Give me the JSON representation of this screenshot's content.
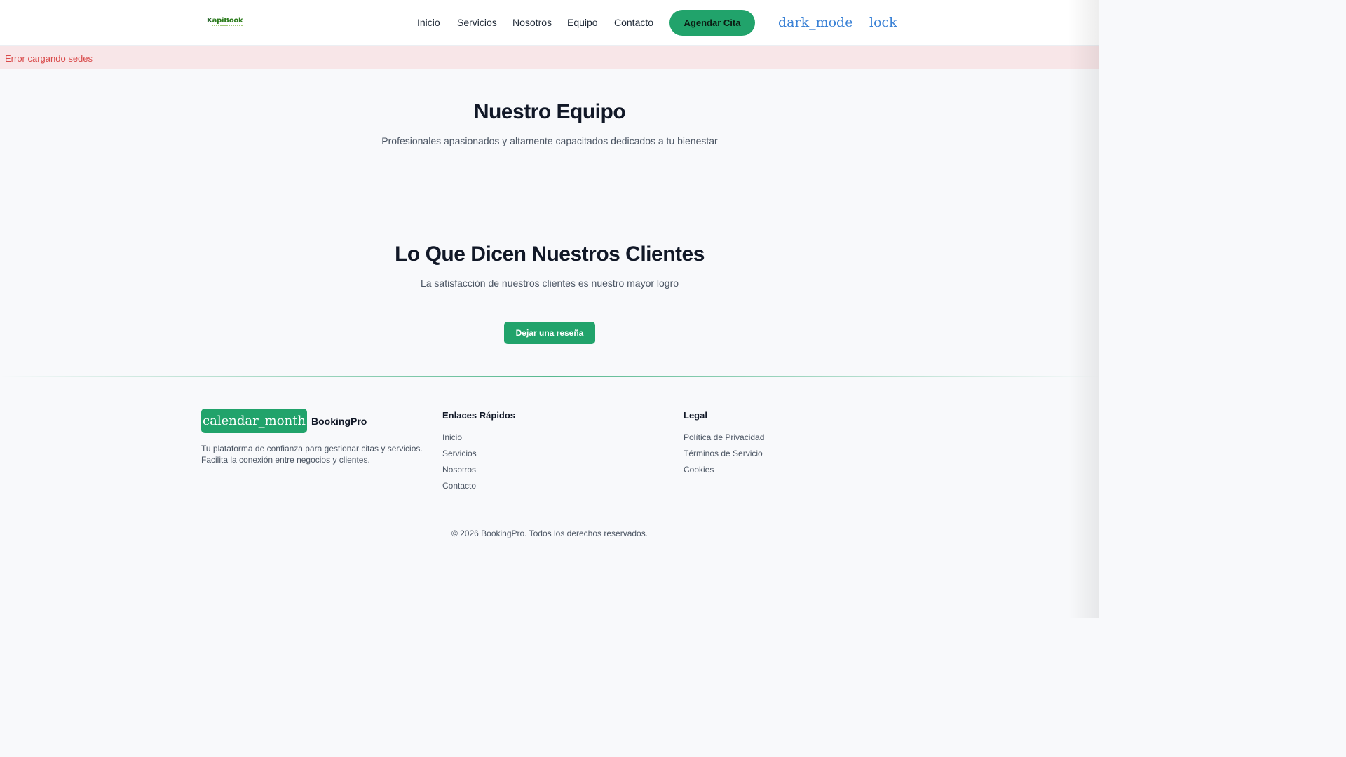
{
  "header": {
    "logo_text_k": "K",
    "logo_text_rest": "apiBook",
    "nav": [
      "Inicio",
      "Servicios",
      "Nosotros",
      "Equipo",
      "Contacto"
    ],
    "cta_label": "Agendar Cita",
    "theme_icon_text": "dark_mode",
    "lock_icon_text": "lock"
  },
  "alert": {
    "error_text": "Error cargando sedes"
  },
  "team_section": {
    "title": "Nuestro Equipo",
    "subtitle": "Profesionales apasionados y altamente capacitados dedicados a tu bienestar"
  },
  "reviews_section": {
    "title": "Lo Que Dicen Nuestros Clientes",
    "subtitle": "La satisfacción de nuestros clientes es nuestro mayor logro",
    "button_label": "Dejar una reseña"
  },
  "footer": {
    "brand_icon_text": "calendar_month",
    "brand_name": "BookingPro",
    "description": "Tu plataforma de confianza para gestionar citas y servicios. Facilita la conexión entre negocios y clientes.",
    "quick_links_title": "Enlaces Rápidos",
    "quick_links": [
      "Inicio",
      "Servicios",
      "Nosotros",
      "Contacto"
    ],
    "legal_title": "Legal",
    "legal_links": [
      "Política de Privacidad",
      "Términos de Servicio",
      "Cookies"
    ],
    "copyright": "© 2026 BookingPro. Todos los derechos reservados."
  },
  "colors": {
    "primary": "#21a36b",
    "error_bg": "#f8e6e8",
    "error_text": "#d94a4a",
    "icon_link": "#3b82d6",
    "background": "#f8f9fb"
  }
}
